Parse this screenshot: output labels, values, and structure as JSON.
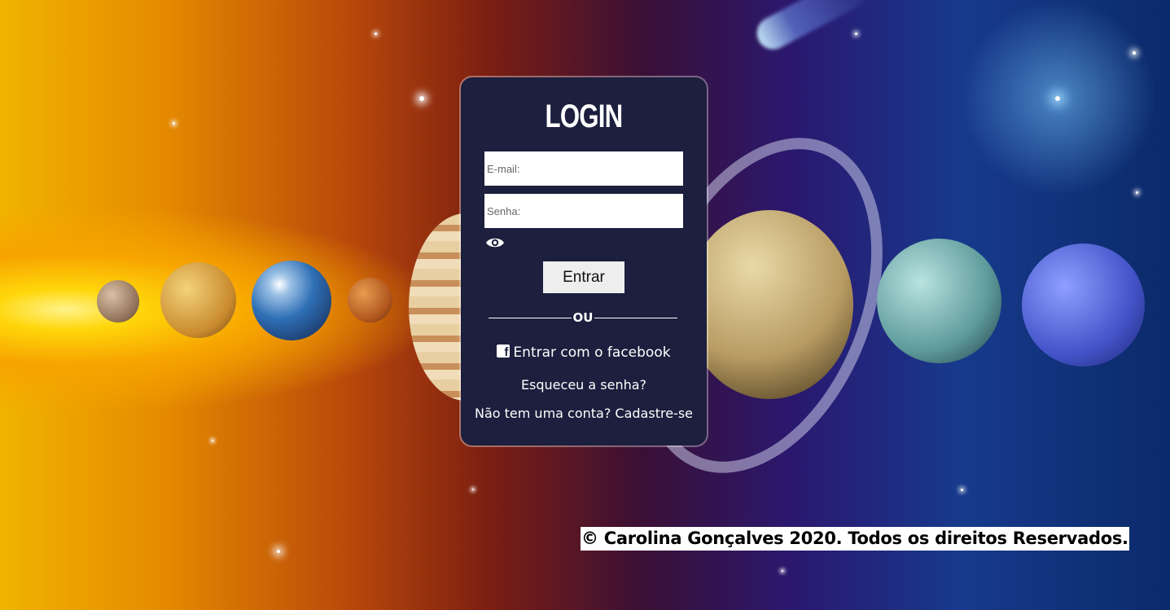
{
  "login": {
    "title": "LOGIN",
    "email_placeholder": "E-mail:",
    "password_placeholder": "Senha:",
    "show_password_icon": "eye-icon",
    "submit_label": "Entrar",
    "divider_text": "OU",
    "facebook_icon": "facebook-icon",
    "facebook_label": "Entrar com o facebook",
    "forgot_password_label": "Esqueceu a senha?",
    "signup_label": "Não tem uma conta? Cadastre-se"
  },
  "footer": {
    "copyright": "© Carolina Gonçalves 2020. Todos os direitos Reservados."
  },
  "colors": {
    "card_background": "#1c1f3d",
    "text": "#ffffff",
    "input_background": "#ffffff",
    "button_background": "#eeeeee"
  }
}
